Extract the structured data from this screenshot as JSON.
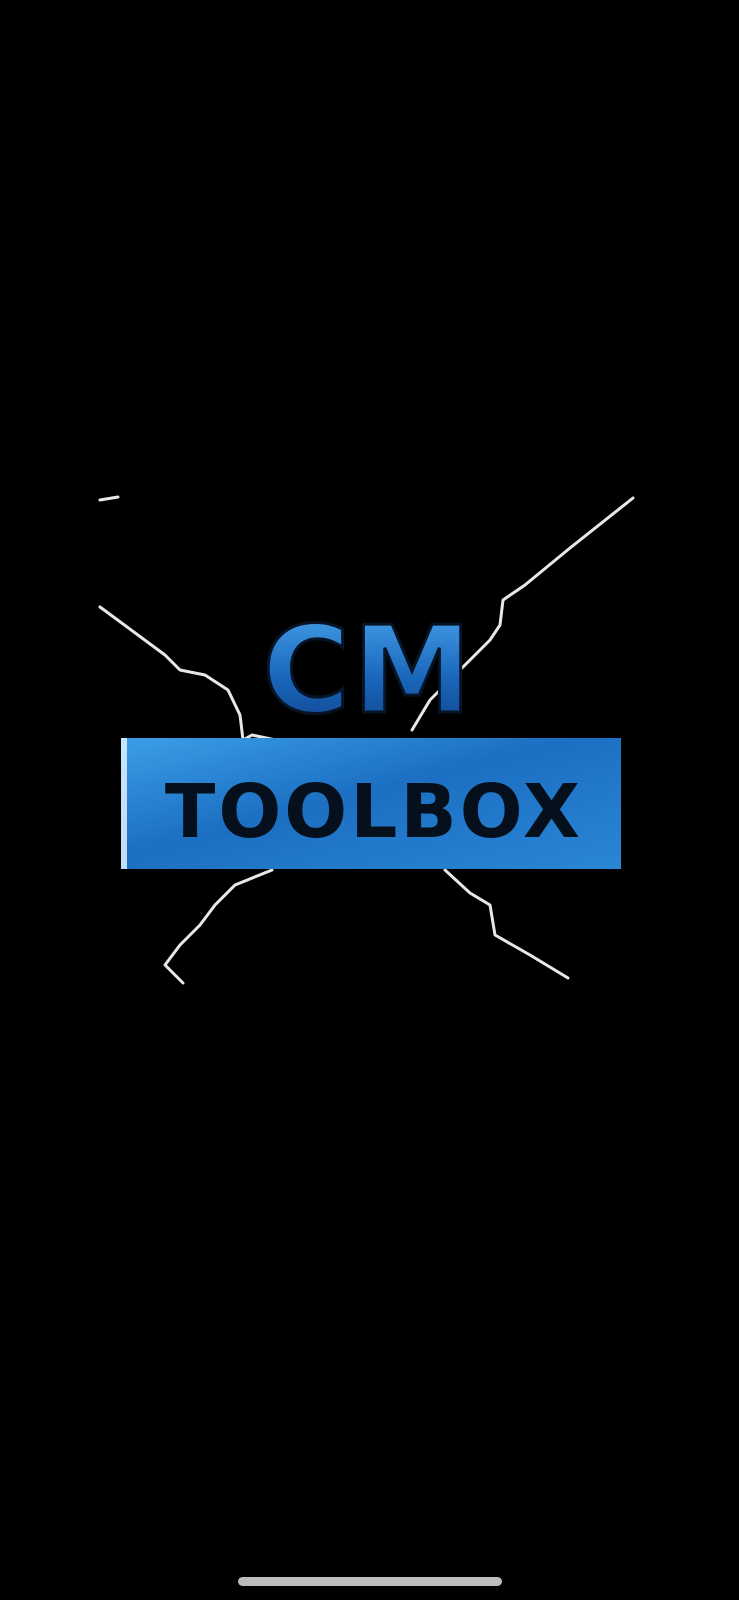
{
  "app": {
    "logo_top_text": "CM",
    "logo_bottom_text": "TOOLBOX"
  },
  "colors": {
    "background": "#000000",
    "logo_blue_light": "#2f8fe0",
    "logo_blue_dark": "#0c4c9a",
    "logo_text_dark": "#06101c",
    "crack_white": "#e8e8e8",
    "home_indicator": "#bdbdbd"
  },
  "icons": {
    "logo": "cm-toolbox-logo",
    "cracks": "lightning-crack-icon"
  }
}
